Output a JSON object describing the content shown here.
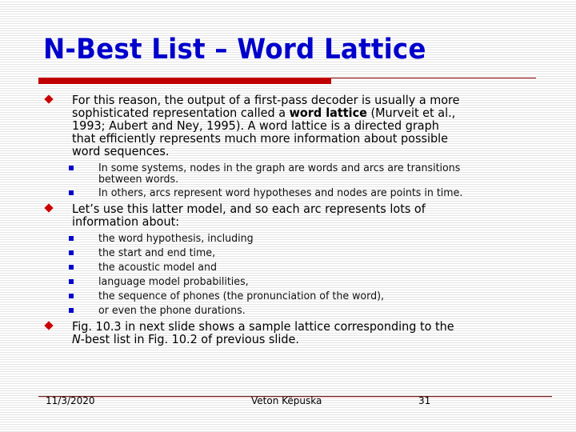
{
  "slide": {
    "title": "N-Best List – Word Lattice",
    "bullets": [
      {
        "lines": [
          "For this reason, the output of a first-pass decoder is usually a more",
          [
            "sophisticated representation called a ",
            "word lattice",
            " (Murveit et al.,"
          ],
          "1993; Aubert and Ney, 1995). A word lattice is a directed graph",
          "that efficiently represents much more information about possible",
          "word sequences."
        ],
        "sub": [
          {
            "lines": [
              "In some systems, nodes in the graph are words and arcs are transitions",
              "between words."
            ]
          },
          {
            "lines": [
              "In others, arcs represent word hypotheses and nodes are points in time."
            ]
          }
        ]
      },
      {
        "lines": [
          "Let’s use this latter model, and so each arc represents lots of",
          "information about:"
        ],
        "sub": [
          {
            "lines": [
              "the word hypothesis, including"
            ]
          },
          {
            "lines": [
              "the start and end time,"
            ]
          },
          {
            "lines": [
              "the acoustic model and"
            ]
          },
          {
            "lines": [
              "language model probabilities,"
            ]
          },
          {
            "lines": [
              "the sequence of phones (the pronunciation of the word),"
            ]
          },
          {
            "lines": [
              "or even the phone durations."
            ]
          }
        ]
      },
      {
        "lines": [
          "Fig. 10.3 in next slide shows a sample lattice corresponding to the",
          [
            "N",
            "-best list in Fig. 10.2 of previous slide."
          ]
        ]
      }
    ]
  },
  "footer": {
    "date": "11/3/2020",
    "author": "Veton Këpuska",
    "page": "31"
  },
  "colors": {
    "title": "#0000cc",
    "accent_bar": "#c00000",
    "bullet_diamond": "#cc0000",
    "bullet_square": "#0000cc"
  }
}
